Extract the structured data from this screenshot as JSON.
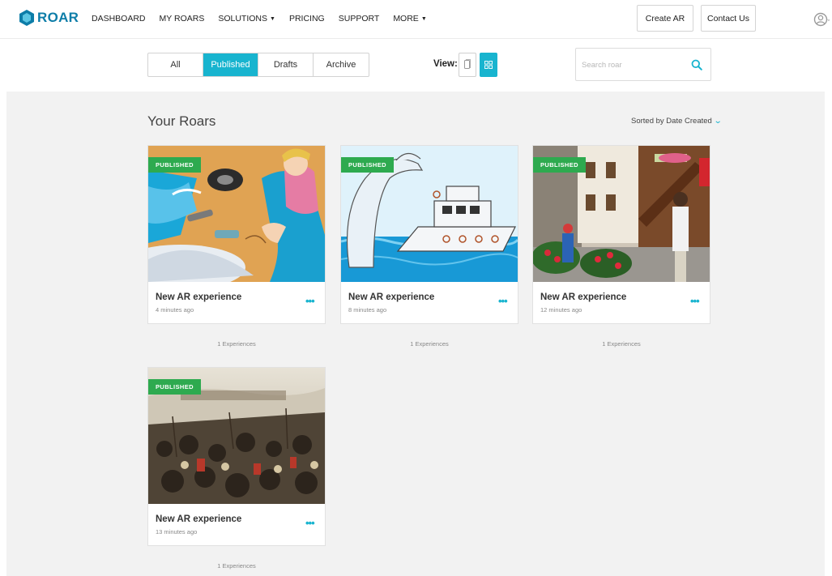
{
  "brand": {
    "name": "ROAR",
    "logo_color": "#0d7da8"
  },
  "nav": {
    "items": [
      {
        "label": "DASHBOARD",
        "dropdown": false
      },
      {
        "label": "MY ROARS",
        "dropdown": false
      },
      {
        "label": "SOLUTIONS",
        "dropdown": true
      },
      {
        "label": "PRICING",
        "dropdown": false
      },
      {
        "label": "SUPPORT",
        "dropdown": false
      },
      {
        "label": "MORE",
        "dropdown": true
      }
    ],
    "create_label": "Create AR",
    "contact_label": "Contact Us",
    "user_icon": "user-circle-icon"
  },
  "toolbar": {
    "filters": [
      {
        "label": "All",
        "active": false
      },
      {
        "label": "Published",
        "active": true
      },
      {
        "label": "Drafts",
        "active": false
      },
      {
        "label": "Archive",
        "active": false
      }
    ],
    "view_label": "View:",
    "view_modes": [
      "list-view-icon",
      "grid-view-icon"
    ],
    "active_view": "grid",
    "search_placeholder": "Search roar",
    "search_icon": "search-icon"
  },
  "content": {
    "title": "Your Roars",
    "sort_label": "Sorted by Date Created",
    "accent_color": "#18b4cf",
    "badge_color": "#2eaa4f",
    "cards": [
      {
        "status": "PUBLISHED",
        "title": "New AR experience",
        "time": "4 minutes ago",
        "experiences": "1 Experiences"
      },
      {
        "status": "PUBLISHED",
        "title": "New AR experience",
        "time": "8 minutes ago",
        "experiences": "1 Experiences"
      },
      {
        "status": "PUBLISHED",
        "title": "New AR experience",
        "time": "12 minutes ago",
        "experiences": "1 Experiences"
      },
      {
        "status": "PUBLISHED",
        "title": "New AR experience",
        "time": "13 minutes ago",
        "experiences": "1 Experiences"
      }
    ]
  }
}
